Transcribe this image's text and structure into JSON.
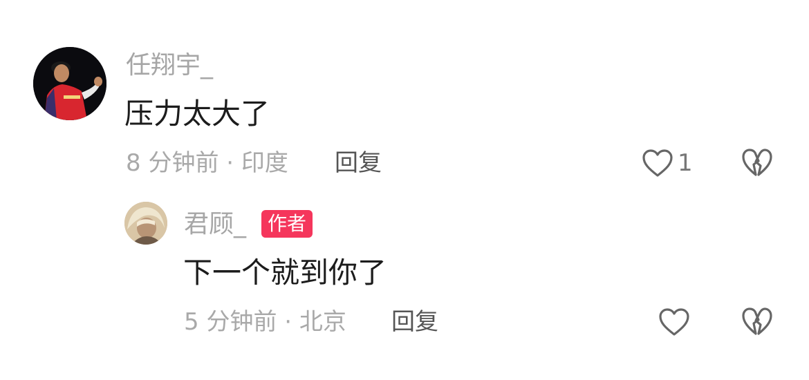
{
  "comments": [
    {
      "username": "任翔宇_",
      "content": "压力太大了",
      "meta": "8 分钟前 · 印度",
      "reply_label": "回复",
      "like_count": "1",
      "avatar": "player-photo-avatar"
    }
  ],
  "replies": [
    {
      "username": "君顾_",
      "badge": "作者",
      "content": "下一个就到你了",
      "meta": "5 分钟前 · 北京",
      "reply_label": "回复",
      "like_count": "",
      "avatar": "anime-character-avatar"
    }
  ],
  "icons": {
    "like": "heart-outline-icon",
    "dislike": "broken-heart-icon"
  },
  "colors": {
    "author_badge": "#f5365c",
    "username": "#a6a6a6",
    "content": "#1c1c1c",
    "meta": "#a9a9a9",
    "icon": "#666666"
  }
}
